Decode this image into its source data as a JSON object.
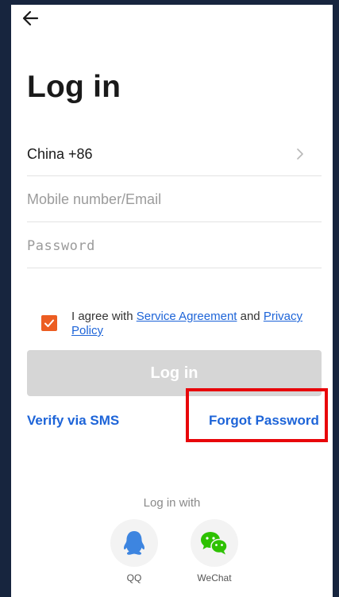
{
  "header": {
    "back_icon": "back-arrow-icon",
    "title": "Log in"
  },
  "form": {
    "country": "China +86",
    "country_chevron_icon": "chevron-right-icon",
    "mobile_placeholder": "Mobile number/Email",
    "mobile_value": "",
    "password_placeholder": "Password",
    "password_value": ""
  },
  "agreement": {
    "checked": true,
    "prefix": "I agree with ",
    "service_link": "Service Agreement",
    "middle": " and ",
    "privacy_link": "Privacy Policy",
    "checkbox_color": "#ec5d22"
  },
  "actions": {
    "login_label": "Log in",
    "verify_sms_label": "Verify via SMS",
    "forgot_password_label": "Forgot Password"
  },
  "social": {
    "heading": "Log in with",
    "items": [
      {
        "label": "QQ",
        "icon": "qq-penguin-icon",
        "color": "#3d85e0"
      },
      {
        "label": "WeChat",
        "icon": "wechat-icon",
        "color": "#2dc100"
      }
    ]
  },
  "colors": {
    "link": "#1d64d8",
    "button_disabled": "#d6d6d6",
    "highlight": "#e8060a",
    "frame": "#17253e"
  }
}
